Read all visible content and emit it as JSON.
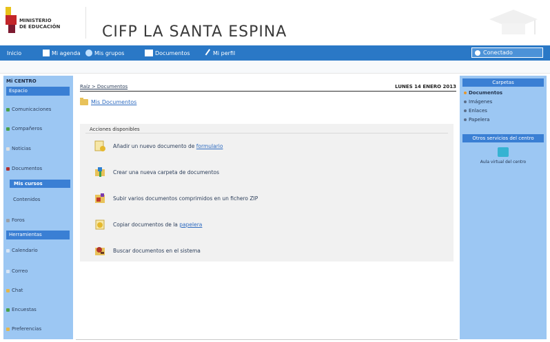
{
  "header": {
    "logo_text_line1": "MINISTERIO",
    "logo_text_line2": "DE EDUCACIÓN",
    "title": "CIFP LA SANTA ESPINA"
  },
  "topnav": {
    "items": [
      {
        "label": "Inicio"
      },
      {
        "label": "Mi agenda"
      },
      {
        "label": "Mis grupos"
      },
      {
        "label": "Documentos"
      },
      {
        "label": "Mi perfil"
      }
    ],
    "right_label": "Conectado"
  },
  "leftbar": {
    "title": "Mi CENTRO",
    "selected_top": "Espacio",
    "items": [
      {
        "label": "Comunicaciones"
      },
      {
        "label": "Compañeros"
      },
      {
        "label": "Noticias"
      },
      {
        "label": "Documentos"
      }
    ],
    "selected_sub": "Mis cursos",
    "sub_item": "Contenidos",
    "item_after": "Foros",
    "section2": "Herramientas",
    "items2": [
      {
        "label": "Calendario"
      },
      {
        "label": "Correo"
      },
      {
        "label": "Chat"
      },
      {
        "label": "Encuestas"
      },
      {
        "label": "Preferencias"
      }
    ]
  },
  "main": {
    "breadcrumb": "Raíz > Documentos",
    "date": "LUNES 14 ENERO 2013",
    "folder_label": "Mis Documentos",
    "panel_title": "Acciones disponibles",
    "actions": [
      {
        "text": "Añadir un nuevo documento de ",
        "link": "formulario"
      },
      {
        "text": "Crear una nueva carpeta de documentos",
        "link": ""
      },
      {
        "text": "Subir varios documentos comprimidos en un fichero ZIP",
        "link": ""
      },
      {
        "text": "Copiar documentos de la ",
        "link": "papelera"
      },
      {
        "text": "Buscar documentos en el sistema",
        "link": ""
      }
    ]
  },
  "rightbar": {
    "header1": "Carpetas",
    "items": [
      {
        "label": "Documentos"
      },
      {
        "label": "Imágenes"
      },
      {
        "label": "Enlaces"
      },
      {
        "label": "Papelera"
      }
    ],
    "header2": "Otros servicios del centro",
    "image_caption": "Aula virtual del centro"
  }
}
